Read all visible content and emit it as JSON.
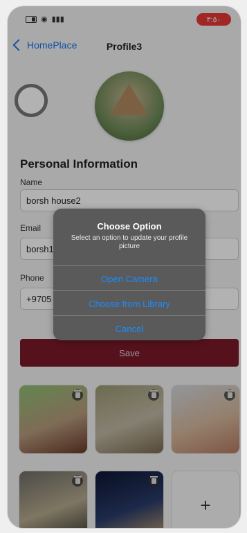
{
  "status": {
    "time": "٣:٥٠"
  },
  "nav": {
    "back_label": "HomePlace",
    "title": "Profile3"
  },
  "profile": {
    "section_title": "Personal Information",
    "name_label": "Name",
    "name_value": "borsh house2",
    "email_label": "Email",
    "email_value": "borsh1",
    "phone_label": "Phone",
    "phone_value": "+9705",
    "save_label": "Save"
  },
  "gallery": {
    "add_label": "+"
  },
  "dialog": {
    "title": "Choose Option",
    "subtitle": "Select an option to update your profile picture",
    "options": [
      "Open Camera",
      "Choose from Library",
      "Cancel"
    ]
  },
  "colors": {
    "accent": "#1a8cff",
    "save": "#7a1a2a",
    "time_pill": "#e53935"
  }
}
